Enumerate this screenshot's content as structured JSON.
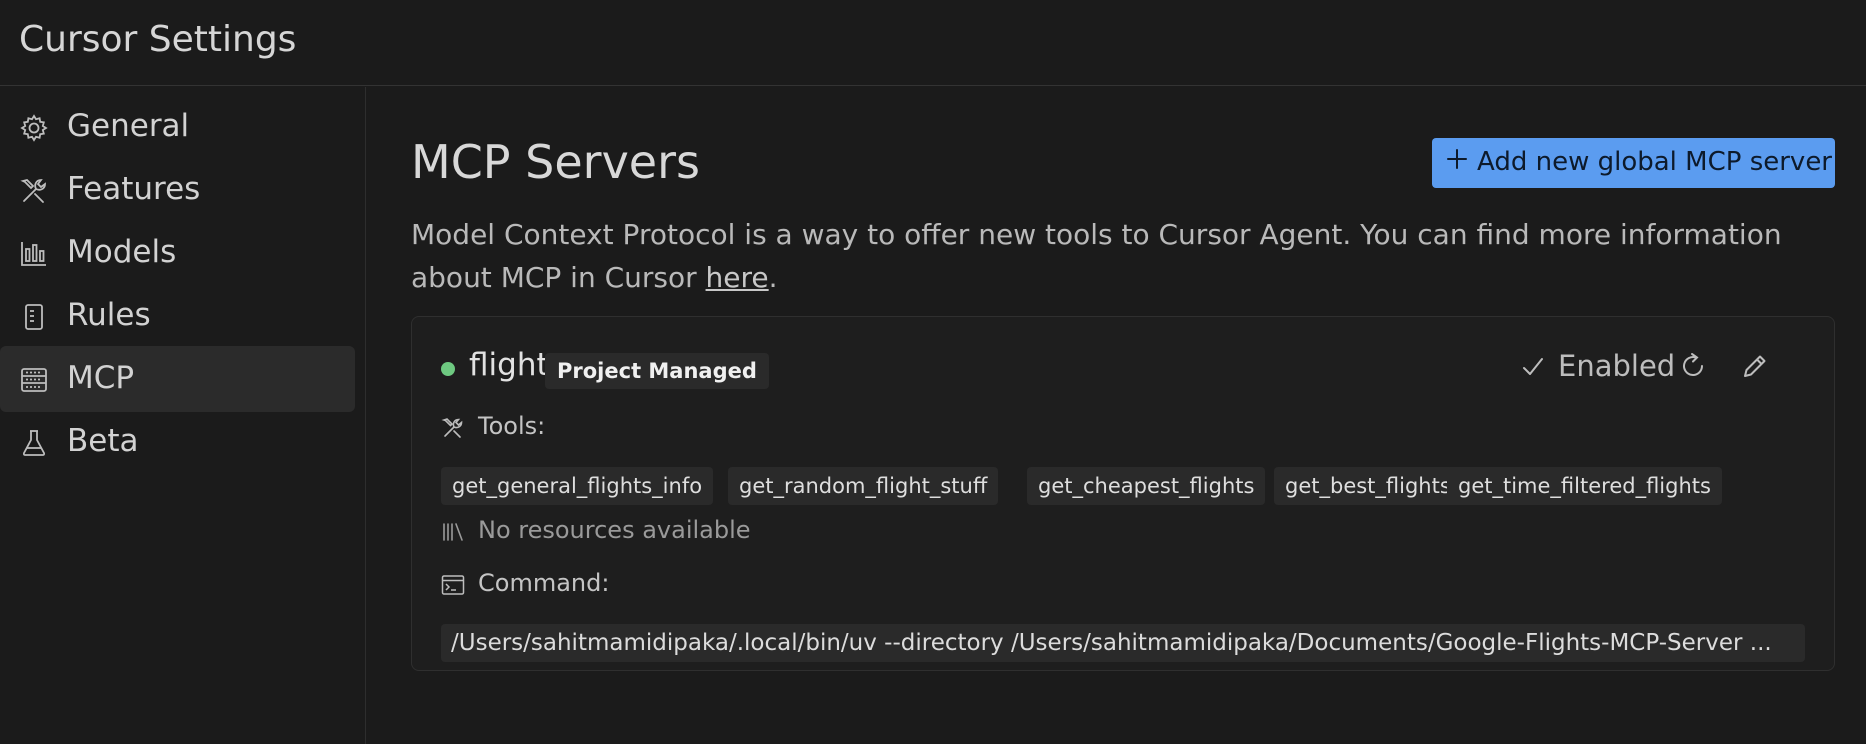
{
  "window": {
    "title": "Cursor Settings"
  },
  "sidebar": {
    "items": [
      {
        "label": "General",
        "icon": "gear-icon",
        "active": false
      },
      {
        "label": "Features",
        "icon": "tools-icon",
        "active": false
      },
      {
        "label": "Models",
        "icon": "bar-chart-icon",
        "active": false
      },
      {
        "label": "Rules",
        "icon": "rules-book-icon",
        "active": false
      },
      {
        "label": "MCP",
        "icon": "server-icon",
        "active": true
      },
      {
        "label": "Beta",
        "icon": "flask-icon",
        "active": false
      }
    ]
  },
  "main": {
    "title": "MCP Servers",
    "add_button_label": "Add new global MCP server",
    "description_text": "Model Context Protocol is a way to offer new tools to Cursor Agent. You can find more information about MCP in Cursor ",
    "description_link": "here",
    "description_end": "."
  },
  "server": {
    "name": "flights",
    "status_color": "#6ec981",
    "badge": "Project Managed",
    "enabled_label": "Enabled",
    "tools_label": "Tools:",
    "tools": [
      "get_general_flights_info",
      "get_random_flight_stuff",
      "get_cheapest_flights",
      "get_best_flights",
      "get_time_filtered_flights"
    ],
    "resources_label": "No resources available",
    "command_label": "Command:",
    "command_value": "/Users/sahitmamidipaka/.local/bin/uv --directory /Users/sahitmamidipaka/Documents/Google-Flights-MCP-Server ..."
  },
  "colors": {
    "background": "#1b1b1b",
    "accent": "#5b9cf0",
    "status_ok": "#6ec981"
  }
}
